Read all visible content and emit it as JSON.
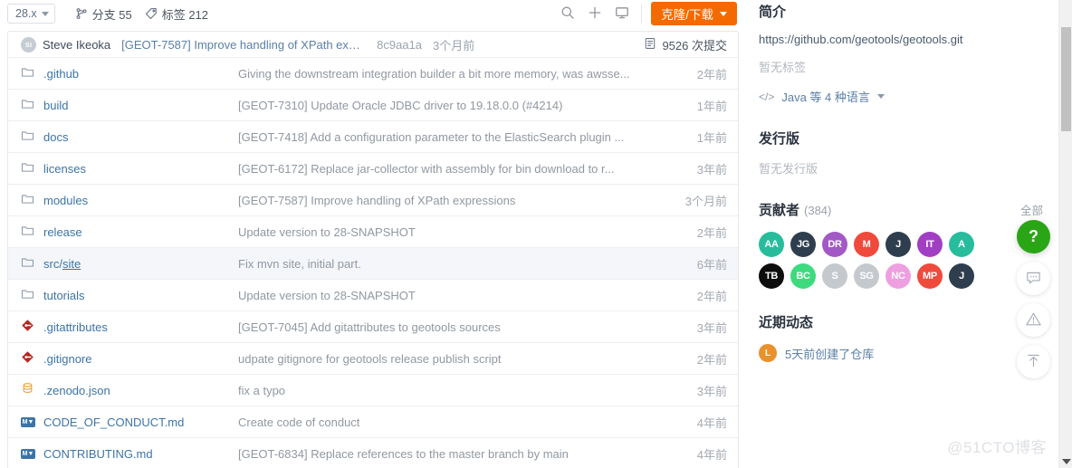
{
  "toolbar": {
    "branch": "28.x",
    "branches_label": "分支 55",
    "tags_label": "标签 212",
    "search_icon": "search-icon",
    "add_icon": "plus-icon",
    "screen_icon": "monitor-icon",
    "clone_label": "克隆/下载",
    "accent_color": "#f56a00"
  },
  "commit_header": {
    "avatar_initials": "SI",
    "author": "Steve Ikeoka",
    "message": "[GEOT-7587] Improve handling of XPath expr...",
    "sha": "8c9aa1a",
    "when": "3个月前",
    "commits_count_label": "9526 次提交"
  },
  "files": [
    {
      "icon": "folder",
      "name": ".github",
      "message": "Giving the downstream integration builder a bit more memory, was awsse...",
      "time": "2年前",
      "highlighted": false
    },
    {
      "icon": "folder",
      "name": "build",
      "message": "[GEOT-7310] Update Oracle JDBC driver to 19.18.0.0 (#4214)",
      "time": "1年前",
      "highlighted": false
    },
    {
      "icon": "folder",
      "name": "docs",
      "message": "[GEOT-7418] Add a configuration parameter to the ElasticSearch plugin ...",
      "time": "1年前",
      "highlighted": false
    },
    {
      "icon": "folder",
      "name": "licenses",
      "message": "[GEOT-6172] Replace jar-collector with assembly for bin download to r...",
      "time": "3年前",
      "highlighted": false
    },
    {
      "icon": "folder",
      "name": "modules",
      "message": "[GEOT-7587] Improve handling of XPath expressions",
      "time": "3个月前",
      "highlighted": false
    },
    {
      "icon": "folder",
      "name": "release",
      "message": "Update version to 28-SNAPSHOT",
      "time": "2年前",
      "highlighted": false
    },
    {
      "icon": "folder",
      "name": "src/site",
      "message": "Fix mvn site, initial part.",
      "time": "6年前",
      "highlighted": true
    },
    {
      "icon": "folder",
      "name": "tutorials",
      "message": "Update version to 28-SNAPSHOT",
      "time": "2年前",
      "highlighted": false
    },
    {
      "icon": "git",
      "name": ".gitattributes",
      "message": "[GEOT-7045] Add gitattributes to geotools sources",
      "time": "3年前",
      "highlighted": false
    },
    {
      "icon": "git",
      "name": ".gitignore",
      "message": "udpate gitignore for geotools release publish script",
      "time": "2年前",
      "highlighted": false
    },
    {
      "icon": "json",
      "name": ".zenodo.json",
      "message": "fix a typo",
      "time": "3年前",
      "highlighted": false
    },
    {
      "icon": "md",
      "name": "CODE_OF_CONDUCT.md",
      "message": "Create code of conduct",
      "time": "4年前",
      "highlighted": false
    },
    {
      "icon": "md",
      "name": "CONTRIBUTING.md",
      "message": "[GEOT-6834] Replace references to the master branch by main",
      "time": "4年前",
      "highlighted": false
    }
  ],
  "sidebar": {
    "about_title": "简介",
    "url": "https://github.com/geotools/geotools.git",
    "no_tags": "暂无标签",
    "language_label": "Java 等 4 种语言",
    "releases_title": "发行版",
    "no_releases": "暂无发行版",
    "contributors_title": "贡献者",
    "contributors_count": "(384)",
    "contributors_all": "全部",
    "contributors": [
      {
        "initials": "AA",
        "color": "#27bd9c"
      },
      {
        "initials": "JG",
        "color": "#2f3e4e"
      },
      {
        "initials": "DR",
        "color": "#a259c6"
      },
      {
        "initials": "M",
        "color": "#ef4a3c"
      },
      {
        "initials": "J",
        "color": "#2f3e4e"
      },
      {
        "initials": "IT",
        "color": "#a13fc4"
      },
      {
        "initials": "A",
        "color": "#27bd9c"
      },
      {
        "initials": "TB",
        "color": "#0d0d0d"
      },
      {
        "initials": "BC",
        "color": "#3ddb7e"
      },
      {
        "initials": "S",
        "color": "#c5c9ce"
      },
      {
        "initials": "SG",
        "color": "#c5c9ce"
      },
      {
        "initials": "NC",
        "color": "#ee9fe0"
      },
      {
        "initials": "MP",
        "color": "#ef4a3c"
      },
      {
        "initials": "J",
        "color": "#2f3e4e"
      }
    ],
    "activity_title": "近期动态",
    "activity_avatar_initials": "L",
    "activity_text": "5天前创建了仓库"
  },
  "fabs": [
    {
      "name": "help-fab",
      "glyph": "?",
      "style": "green"
    },
    {
      "name": "feedback-fab",
      "glyph": "",
      "style": "plain"
    },
    {
      "name": "report-fab",
      "glyph": "",
      "style": "plain"
    },
    {
      "name": "top-fab",
      "glyph": "",
      "style": "plain"
    }
  ],
  "watermark": "@51CTO博客"
}
